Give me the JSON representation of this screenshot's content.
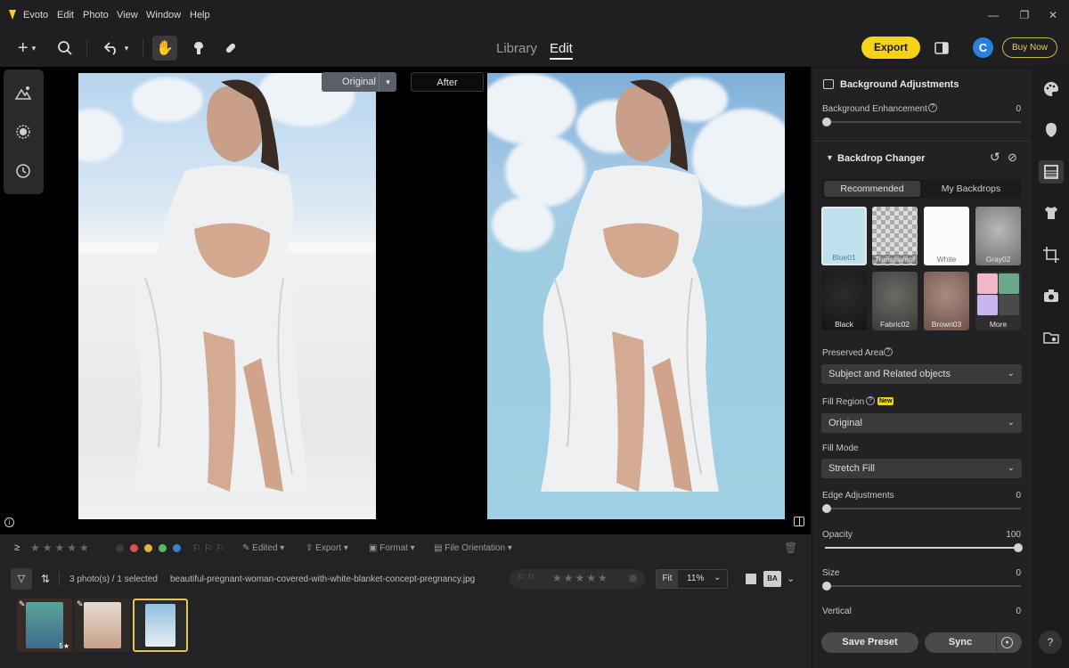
{
  "menu": {
    "app_name": "Evoto",
    "items": [
      "Edit",
      "Photo",
      "View",
      "Window",
      "Help"
    ]
  },
  "toolbar": {
    "tabs": [
      "Library",
      "Edit"
    ],
    "active_tab": "Edit",
    "export_label": "Export",
    "avatar_initial": "C",
    "buy_label": "Buy Now",
    "accent": "#f6d21a"
  },
  "canvas": {
    "original_label": "Original",
    "after_label": "After"
  },
  "panel": {
    "bg_section_title": "Background Adjustments",
    "bg_enhancement_label": "Background Enhancement",
    "bg_enhancement_value": "0",
    "backdrop_title": "Backdrop Changer",
    "tab_recommended": "Recommended",
    "tab_my": "My Backdrops",
    "swatches": [
      "Blue01",
      "Transparent",
      "White",
      "Gray02",
      "Black",
      "Fabric02",
      "Brown03",
      "More"
    ],
    "preserved_label": "Preserved Area",
    "preserved_value": "Subject and Related objects",
    "fill_region_label": "Fill Region",
    "new_badge": "New",
    "fill_region_value": "Original",
    "fill_mode_label": "Fill Mode",
    "fill_mode_value": "Stretch Fill",
    "edge_label": "Edge Adjustments",
    "edge_value": "0",
    "opacity_label": "Opacity",
    "opacity_value": "100",
    "size_label": "Size",
    "size_value": "0",
    "vertical_label": "Vertical",
    "vertical_value": "0",
    "save_preset": "Save Preset",
    "sync": "Sync"
  },
  "filmstrip": {
    "edited_label": "Edited",
    "export_label": "Export",
    "format_label": "Format",
    "orientation_label": "File Orientation",
    "count_text": "3 photo(s) / 1 selected",
    "filename": "beautiful-pregnant-woman-covered-with-white-blanket-concept-pregnancy.jpg",
    "fit_label": "Fit",
    "zoom_value": "11%",
    "thumb1_rating": "5★",
    "label_colors": [
      "#3a3a3c",
      "#d9534f",
      "#e0b93a",
      "#5cb85c",
      "#3b82c4"
    ]
  }
}
